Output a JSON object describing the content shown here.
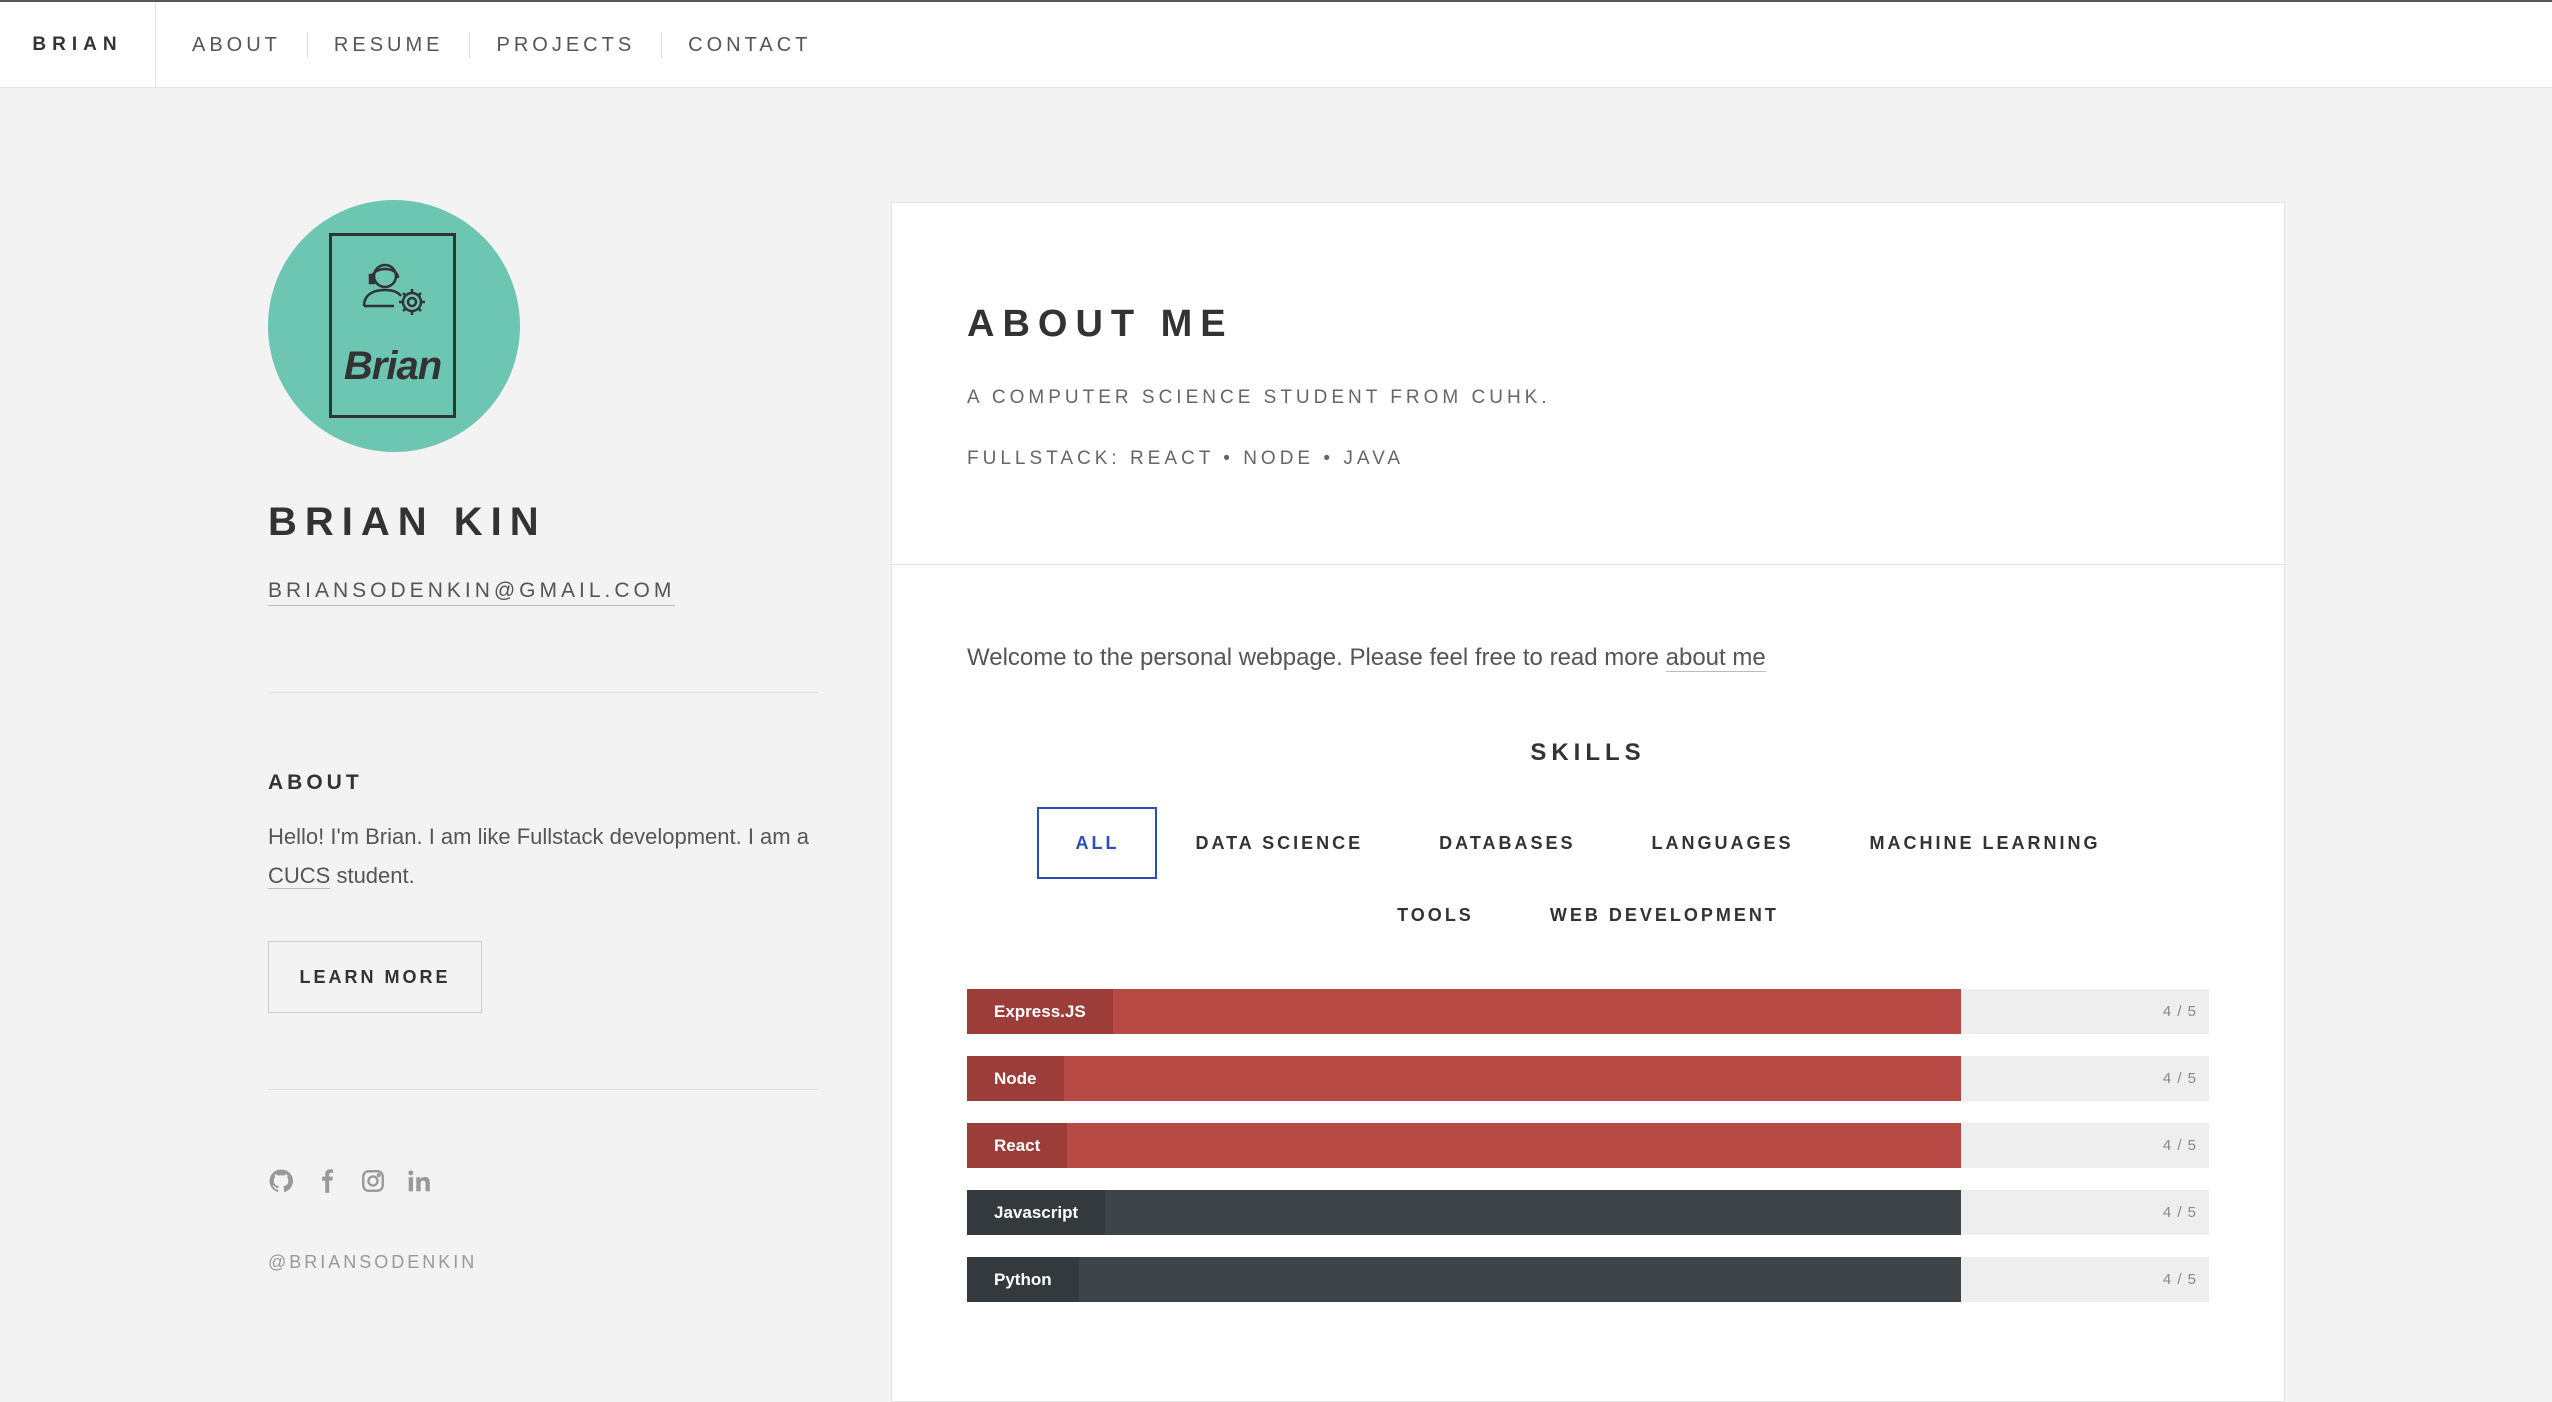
{
  "nav": {
    "brand": "BRIAN",
    "links": [
      "ABOUT",
      "RESUME",
      "PROJECTS",
      "CONTACT"
    ]
  },
  "profile": {
    "logo_text": "Brian",
    "name": "BRIAN KIN",
    "email": "BRIANSODENKIN@GMAIL.COM",
    "about_title": "ABOUT",
    "about_text_1": "Hello! I'm Brian. I am like Fullstack development. I am a ",
    "about_text_link": "CUCS",
    "about_text_2": " student.",
    "learn_more": "LEARN MORE",
    "socials": [
      "github-icon",
      "facebook-icon",
      "instagram-icon",
      "linkedin-icon"
    ],
    "handle": "@BRIANSODENKIN"
  },
  "main": {
    "title": "ABOUT ME",
    "subtitle_1": "A COMPUTER SCIENCE STUDENT FROM CUHK.",
    "subtitle_2": "FULLSTACK: REACT • NODE • JAVA",
    "welcome_text": "Welcome to the personal webpage. Please feel free to read more ",
    "welcome_link": "about me",
    "skills_title": "SKILLS",
    "tabs": [
      "ALL",
      "DATA SCIENCE",
      "DATABASES",
      "LANGUAGES",
      "MACHINE LEARNING",
      "TOOLS",
      "WEB DEVELOPMENT"
    ],
    "active_tab": "ALL",
    "skills": [
      {
        "name": "Express.JS",
        "score": "4 / 5",
        "level": 0.8,
        "color": "#b74a45",
        "tag_color": "#9d3d39"
      },
      {
        "name": "Node",
        "score": "4 / 5",
        "level": 0.8,
        "color": "#b74a45",
        "tag_color": "#9d3d39"
      },
      {
        "name": "React",
        "score": "4 / 5",
        "level": 0.8,
        "color": "#b74a45",
        "tag_color": "#9d3d39"
      },
      {
        "name": "Javascript",
        "score": "4 / 5",
        "level": 0.8,
        "color": "#3e4548",
        "tag_color": "#33393c"
      },
      {
        "name": "Python",
        "score": "4 / 5",
        "level": 0.8,
        "color": "#3e4548",
        "tag_color": "#33393c"
      }
    ]
  },
  "colors": {
    "accent_blue": "#2c4fb4",
    "avatar_teal": "#6cc6b1",
    "background": "#f3f3f3"
  }
}
